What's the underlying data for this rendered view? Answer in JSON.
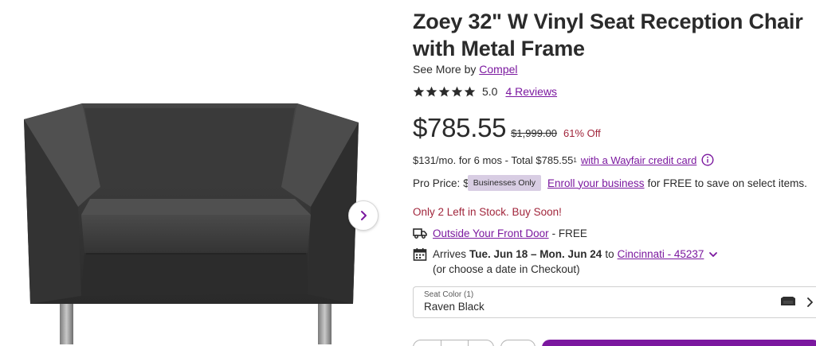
{
  "product": {
    "title": "Zoey 32\" W Vinyl Seat Reception Chair with Metal Frame",
    "see_more_prefix": "See More by",
    "brand": "Compel",
    "rating_value": "5.0",
    "rating_stars": 5,
    "reviews_link": "4 Reviews"
  },
  "pricing": {
    "price": "$785.55",
    "was_price": "$1,999.00",
    "discount": "61% Off",
    "financing_text": "$131/mo. for 6 mos - Total $785.55",
    "financing_sup": "1",
    "financing_link": "with a Wayfair credit card",
    "pro_label": "Pro Price:",
    "pro_dollar": "$",
    "pro_badge": "Businesses Only",
    "enroll_link": "Enroll your business",
    "pro_rest": "for FREE to save on select items."
  },
  "availability": {
    "stock": "Only 2 Left in Stock. Buy Soon!",
    "delivery_link": "Outside Your Front Door",
    "delivery_cost": "- FREE",
    "arrives_prefix": "Arrives",
    "arrives_dates": "Tue. Jun 18 – Mon. Jun 24",
    "to_text": "to",
    "zip_link": "Cincinnati - 45237",
    "checkout_note": "(or choose a date in Checkout)"
  },
  "options": {
    "seat_color_label": "Seat Color (1)",
    "seat_color_value": "Raven Black"
  },
  "icons": {
    "next": "chevron-right-icon",
    "star": "star-icon",
    "info": "info-icon",
    "truck": "truck-icon",
    "calendar": "calendar-icon",
    "chevron_down": "chevron-down-icon",
    "chevron_right": "chevron-right-icon"
  },
  "colors": {
    "link_purple": "#7b189f",
    "alert_red": "#a1263c",
    "badge_bg": "#d8cde3"
  }
}
